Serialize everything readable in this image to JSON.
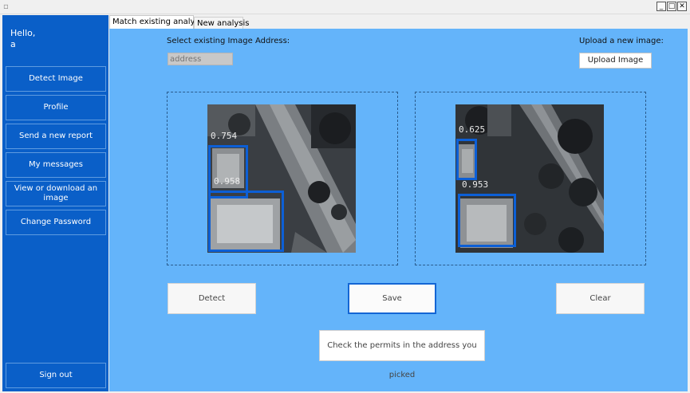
{
  "window": {
    "minimize_glyph": "_",
    "maximize_glyph": "□",
    "close_glyph": "✕"
  },
  "sidebar": {
    "greeting": "Hello,",
    "username": "a",
    "items": [
      {
        "label": "Detect Image"
      },
      {
        "label": "Profile"
      },
      {
        "label": "Send a new report"
      },
      {
        "label": "My messages"
      },
      {
        "label": "View or download an image"
      },
      {
        "label": "Change Password"
      }
    ],
    "sign_out_label": "Sign out"
  },
  "tabs": [
    {
      "label": "Match existing analysis",
      "active": true
    },
    {
      "label": "New analysis",
      "active": false
    }
  ],
  "main": {
    "select_label": "Select existing Image Address:",
    "address_placeholder": "address",
    "upload_label": "Upload a new image:",
    "upload_button": "Upload Image",
    "left_image": {
      "detections": [
        {
          "score": "0.754"
        },
        {
          "score": "0.958"
        }
      ]
    },
    "right_image": {
      "detections": [
        {
          "score": "0.625"
        },
        {
          "score": "0.953"
        }
      ]
    },
    "detect_button": "Detect",
    "save_button": "Save",
    "clear_button": "Clear",
    "permits_button": "Check the permits in the address you picked"
  },
  "colors": {
    "sidebar": "#0a5fc8",
    "main_background": "#64b4fa",
    "detection_box": "#0c5fd6"
  }
}
